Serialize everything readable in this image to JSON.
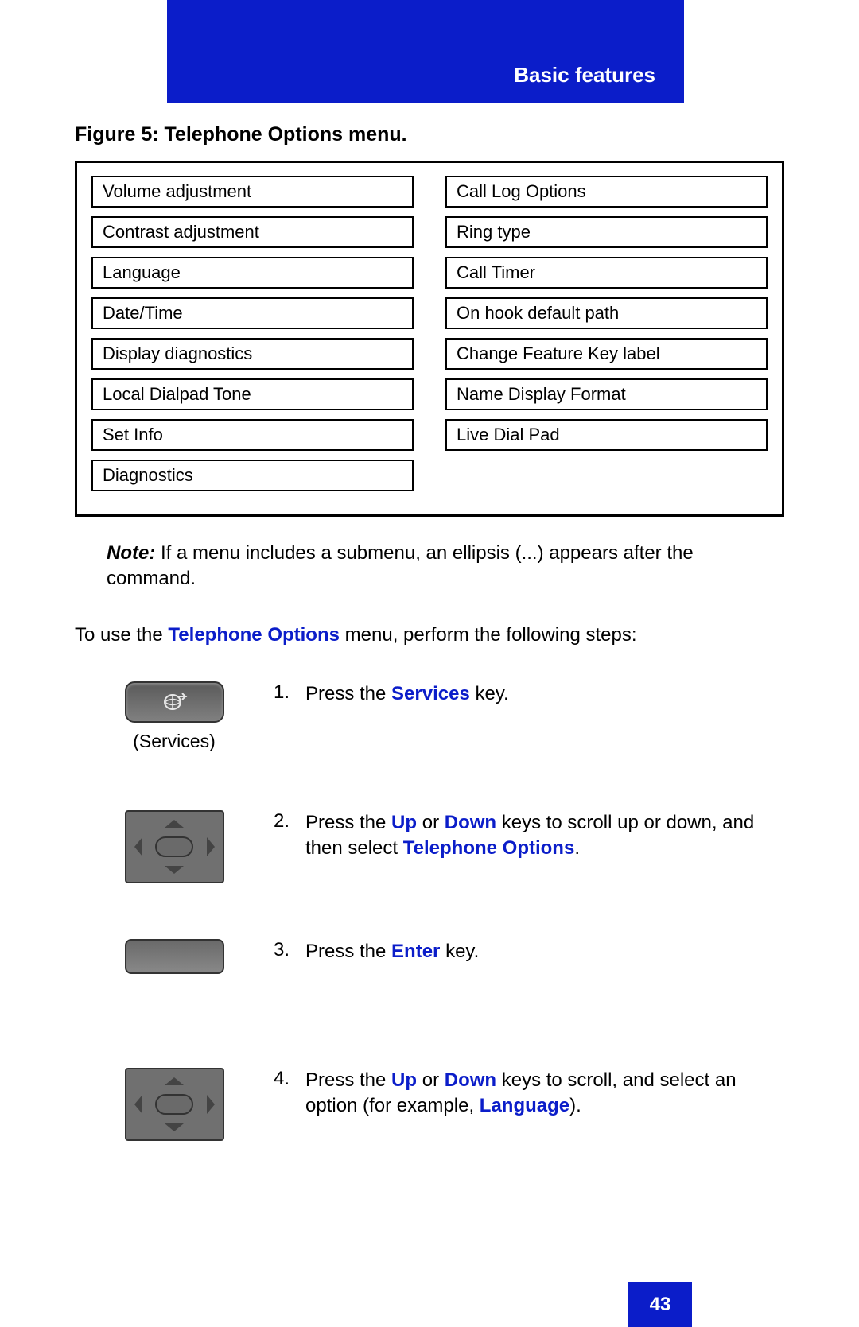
{
  "header": {
    "title": "Basic features"
  },
  "figure": {
    "caption": "Figure 5:  Telephone Options menu."
  },
  "menu": {
    "left": [
      "Volume adjustment",
      "Contrast adjustment",
      "Language",
      "Date/Time",
      "Display diagnostics",
      "Local Dialpad Tone",
      "Set Info",
      "Diagnostics"
    ],
    "right": [
      "Call Log Options",
      "Ring type",
      "Call Timer",
      "On hook default path",
      "Change Feature Key label",
      "Name Display Format",
      "Live Dial Pad"
    ]
  },
  "note": {
    "label": "Note:",
    "text": " If a menu includes a submenu, an ellipsis (...) appears after the command."
  },
  "intro": {
    "pre": "To use the ",
    "kw": "Telephone Options",
    "post": " menu, perform the following steps:"
  },
  "steps": {
    "s1": {
      "num": "1.",
      "t1": "Press the ",
      "kw1": "Services",
      "t2": " key.",
      "caption": "(Services)"
    },
    "s2": {
      "num": "2.",
      "t1": "Press the ",
      "kw1": "Up",
      "t2": " or ",
      "kw2": "Down",
      "t3": " keys to scroll up or down, and then select ",
      "kw3": "Telephone Options",
      "t4": "."
    },
    "s3": {
      "num": "3.",
      "t1": "Press the ",
      "kw1": "Enter",
      "t2": " key."
    },
    "s4": {
      "num": "4.",
      "t1": "Press the ",
      "kw1": "Up",
      "t2": " or ",
      "kw2": "Down",
      "t3": " keys to scroll, and select an option (for example, ",
      "kw3": "Language",
      "t4": ")."
    }
  },
  "page": {
    "number": "43"
  }
}
